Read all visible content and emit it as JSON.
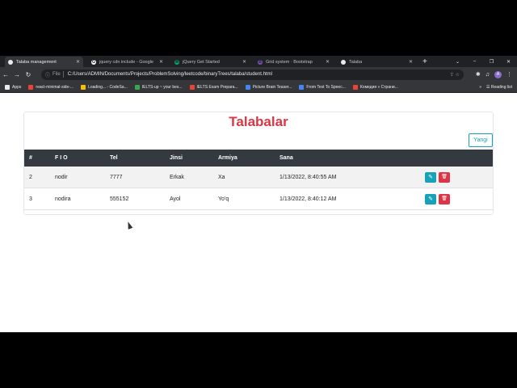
{
  "browser": {
    "tabs": [
      {
        "title": "Talaba management",
        "favColor": "#e8eaed",
        "favText": "",
        "active": true
      },
      {
        "title": "jquery cdn include - Google",
        "favColor": "#ffffff",
        "favText": "G",
        "active": false
      },
      {
        "title": "jQuery Get Started",
        "favColor": "#04aa6d",
        "favText": "W",
        "active": false
      },
      {
        "title": "Grid system · Bootstrap",
        "favColor": "#7952b3",
        "favText": "B",
        "active": false
      },
      {
        "title": "Talaba",
        "favColor": "#e8eaed",
        "favText": "",
        "active": false
      }
    ],
    "new_tab": "+",
    "window_controls": [
      "⌄",
      "–",
      "❐",
      "✕"
    ],
    "address": {
      "scheme": "File",
      "url": "C:/Users/ADMIN/Documents/Projects/ProblemSolving/leetcode/binaryTrees/talaba/student.html"
    },
    "bookmarks": [
      {
        "label": "Apps",
        "color": "#e8eaed"
      },
      {
        "label": "react-minimal-side-...",
        "color": "#ea4335"
      },
      {
        "label": "Loading... - CodeSa...",
        "color": "#fbbc04"
      },
      {
        "label": "IELTS-up ~ your bes...",
        "color": "#34a853"
      },
      {
        "label": "IELTS Exam Prepara...",
        "color": "#ea4335"
      },
      {
        "label": "Picture Brain Teaser...",
        "color": "#4285f4"
      },
      {
        "label": "From Text To Speec...",
        "color": "#4285f4"
      },
      {
        "label": "Комедия » Страни...",
        "color": "#ea4335"
      }
    ],
    "bookmarks_more": "»",
    "reading_list": "Reading list",
    "profile_initial": "A"
  },
  "page": {
    "title": "Talabalar",
    "new_button": "Yangi",
    "columns": [
      "#",
      "F I O",
      "Tel",
      "Jinsi",
      "Armiya",
      "Sana"
    ],
    "rows": [
      {
        "id": "2",
        "name": "nodir",
        "tel": "7777",
        "gender": "Erkak",
        "army": "Xa",
        "date": "1/13/2022, 8:40:55 AM"
      },
      {
        "id": "3",
        "name": "nodira",
        "tel": "555152",
        "gender": "Ayol",
        "army": "Yo'q",
        "date": "1/13/2022, 8:40:12 AM"
      }
    ]
  }
}
